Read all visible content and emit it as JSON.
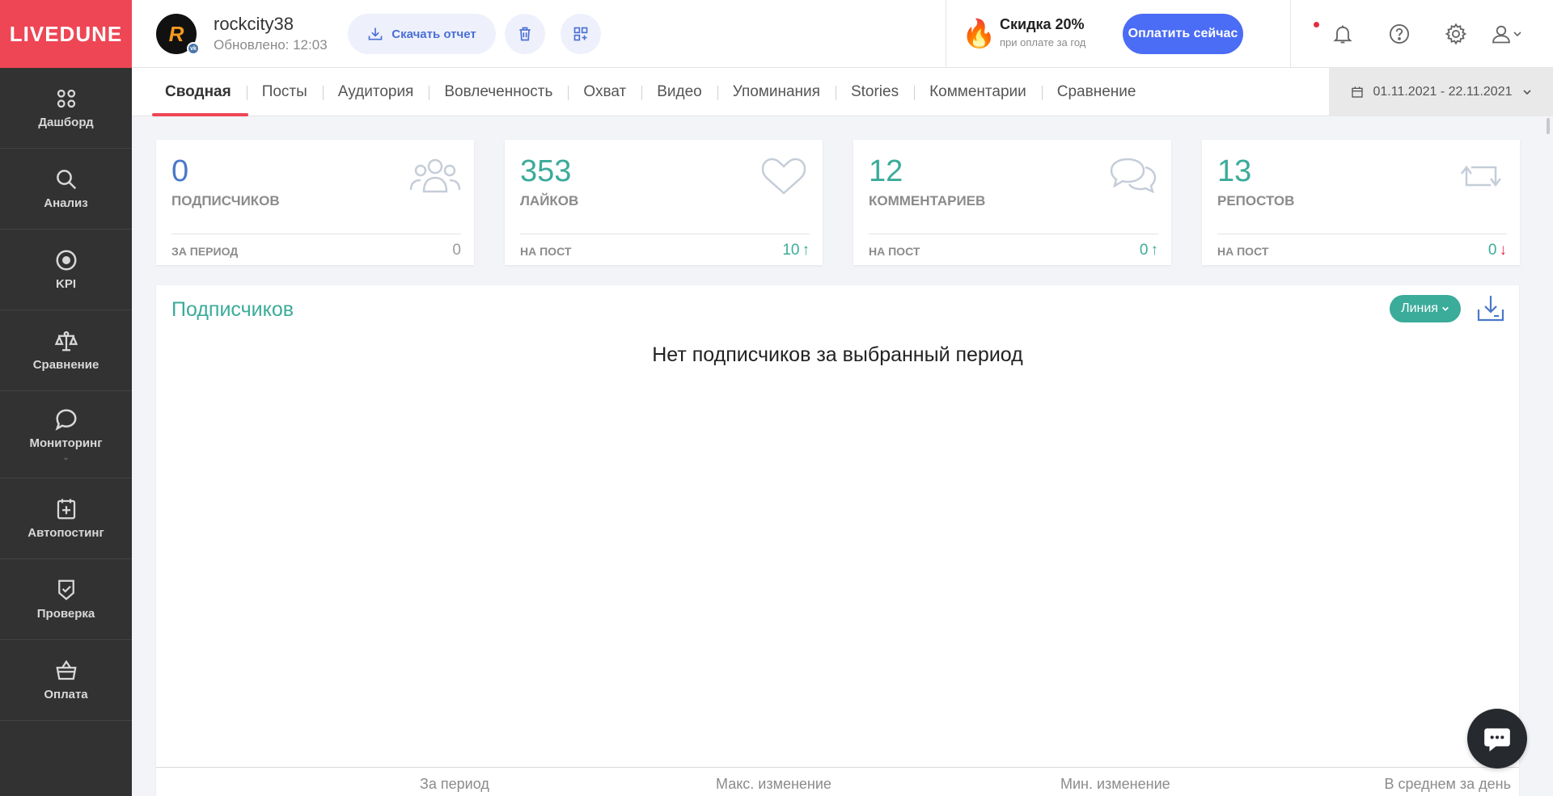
{
  "brand": "LIVEDUNE",
  "sidebar": {
    "items": [
      {
        "label": "Дашборд",
        "icon": "dashboard-icon"
      },
      {
        "label": "Анализ",
        "icon": "search-icon"
      },
      {
        "label": "KPI",
        "icon": "target-icon"
      },
      {
        "label": "Сравнение",
        "icon": "scales-icon"
      },
      {
        "label": "Мониторинг",
        "icon": "speech-bubble-icon"
      },
      {
        "label": "Автопостинг",
        "icon": "calendar-plus-icon"
      },
      {
        "label": "Проверка",
        "icon": "shield-check-icon"
      },
      {
        "label": "Оплата",
        "icon": "basket-icon"
      }
    ]
  },
  "account": {
    "name": "rockcity38",
    "updated": "Обновлено: 12:03",
    "avatar_letter": "R",
    "network_badge": "vk"
  },
  "toolbar": {
    "download_label": "Скачать отчет"
  },
  "promo": {
    "title": "Скидка 20%",
    "subtitle": "при оплате за год",
    "pay_label": "Оплатить сейчас"
  },
  "tabs": [
    "Сводная",
    "Посты",
    "Аудитория",
    "Вовлеченность",
    "Охват",
    "Видео",
    "Упоминания",
    "Stories",
    "Комментарии",
    "Сравнение"
  ],
  "date_range": "01.11.2021 - 22.11.2021",
  "stats": [
    {
      "value": "0",
      "label": "ПОДПИСЧИКОВ",
      "sub": "ЗА ПЕРИОД",
      "delta": "0",
      "trend": "none",
      "color": "#4a78c8",
      "icon": "users-icon"
    },
    {
      "value": "353",
      "label": "ЛАЙКОВ",
      "sub": "НА ПОСТ",
      "delta": "10",
      "trend": "up",
      "color": "#3bab9a",
      "icon": "heart-icon"
    },
    {
      "value": "12",
      "label": "КОММЕНТАРИЕВ",
      "sub": "НА ПОСТ",
      "delta": "0",
      "trend": "up",
      "color": "#3bab9a",
      "icon": "comments-icon"
    },
    {
      "value": "13",
      "label": "РЕПОСТОВ",
      "sub": "НА ПОСТ",
      "delta": "0",
      "trend": "down",
      "color": "#3bab9a",
      "icon": "repost-icon"
    }
  ],
  "panel": {
    "title": "Подписчиков",
    "view_label": "Линия",
    "empty_message": "Нет подписчиков за выбранный период",
    "footer": [
      "За период",
      "Макс. изменение",
      "Мин. изменение",
      "В среднем за день"
    ]
  },
  "colors": {
    "brand": "#ee4655",
    "accent": "#3bab9a",
    "primary": "#4b6cf5",
    "sidebar": "#323232"
  }
}
